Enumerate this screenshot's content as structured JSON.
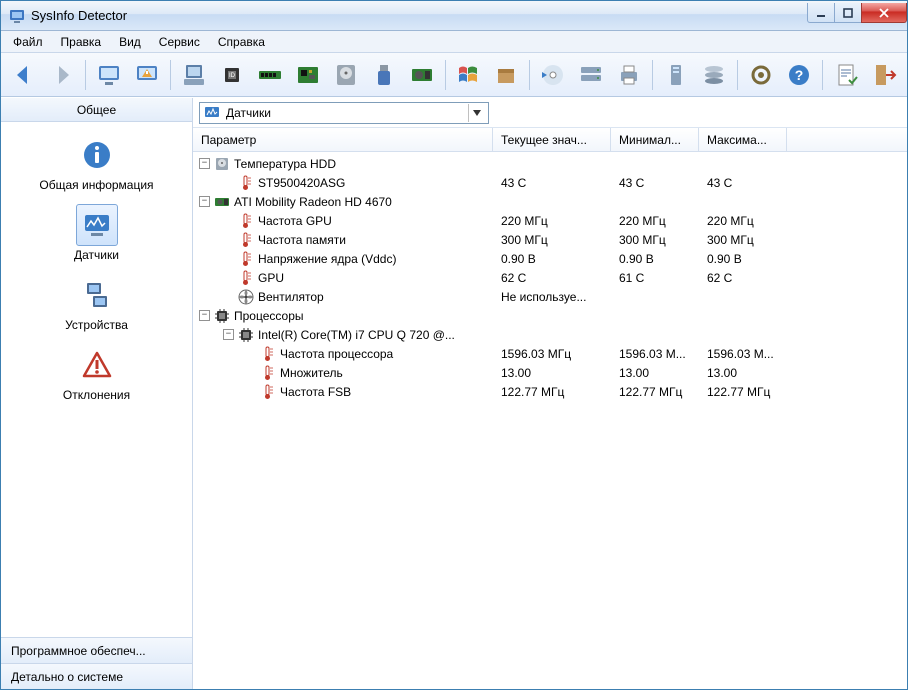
{
  "window": {
    "title": "SysInfo Detector"
  },
  "menu": {
    "file": "Файл",
    "edit": "Правка",
    "view": "Вид",
    "service": "Сервис",
    "help": "Справка"
  },
  "sidebar": {
    "header": "Общее",
    "items": [
      {
        "label": "Общая информация"
      },
      {
        "label": "Датчики"
      },
      {
        "label": "Устройства"
      },
      {
        "label": "Отклонения"
      }
    ],
    "footer": {
      "software": "Программное обеспеч...",
      "details": "Детально о системе"
    }
  },
  "combo": {
    "label": "Датчики"
  },
  "columns": {
    "param": "Параметр",
    "current": "Текущее знач...",
    "min": "Минимал...",
    "max": "Максима..."
  },
  "rows": [
    {
      "type": "group",
      "level": 1,
      "icon": "hdd",
      "label": "Температура HDD"
    },
    {
      "type": "item",
      "level": 2,
      "icon": "temp",
      "label": "ST9500420ASG",
      "cur": "43 C",
      "min": "43 C",
      "max": "43 C"
    },
    {
      "type": "group",
      "level": 1,
      "icon": "gpu",
      "label": "ATI Mobility Radeon HD 4670"
    },
    {
      "type": "item",
      "level": 2,
      "icon": "temp",
      "label": "Частота GPU",
      "cur": "220 МГц",
      "min": "220 МГц",
      "max": "220 МГц"
    },
    {
      "type": "item",
      "level": 2,
      "icon": "temp",
      "label": "Частота памяти",
      "cur": "300 МГц",
      "min": "300 МГц",
      "max": "300 МГц"
    },
    {
      "type": "item",
      "level": 2,
      "icon": "temp",
      "label": "Напряжение ядра (Vddc)",
      "cur": "0.90 В",
      "min": "0.90 В",
      "max": "0.90 В"
    },
    {
      "type": "item",
      "level": 2,
      "icon": "temp",
      "label": "GPU",
      "cur": "62 C",
      "min": "61 C",
      "max": "62 C"
    },
    {
      "type": "item",
      "level": 2,
      "icon": "fan",
      "label": "Вентилятор",
      "cur": "Не используе...",
      "min": "",
      "max": ""
    },
    {
      "type": "group",
      "level": 1,
      "icon": "cpu",
      "label": "Процессоры"
    },
    {
      "type": "group",
      "level": 2,
      "icon": "cpu",
      "label": "Intel(R) Core(TM) i7 CPU Q 720 @..."
    },
    {
      "type": "item",
      "level": 3,
      "icon": "temp",
      "label": "Частота процессора",
      "cur": "1596.03 МГц",
      "min": "1596.03 М...",
      "max": "1596.03 М..."
    },
    {
      "type": "item",
      "level": 3,
      "icon": "temp",
      "label": "Множитель",
      "cur": "13.00",
      "min": "13.00",
      "max": "13.00"
    },
    {
      "type": "item",
      "level": 3,
      "icon": "temp",
      "label": "Частота FSB",
      "cur": "122.77 МГц",
      "min": "122.77 МГц",
      "max": "122.77 МГц"
    }
  ]
}
